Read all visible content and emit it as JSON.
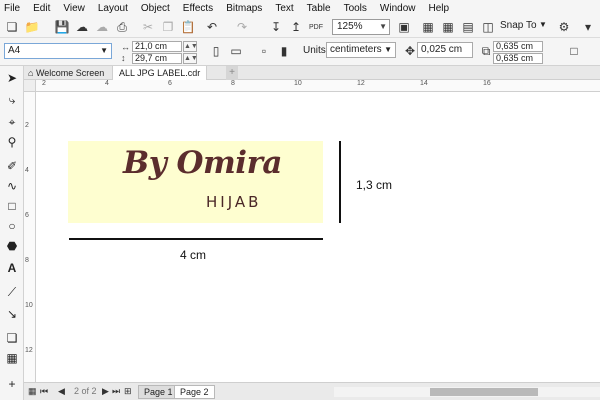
{
  "menu": [
    {
      "label": "File",
      "name": "menu-file"
    },
    {
      "label": "Edit",
      "name": "menu-edit"
    },
    {
      "label": "View",
      "name": "menu-view"
    },
    {
      "label": "Layout",
      "name": "menu-layout"
    },
    {
      "label": "Object",
      "name": "menu-object"
    },
    {
      "label": "Effects",
      "name": "menu-effects"
    },
    {
      "label": "Bitmaps",
      "name": "menu-bitmaps"
    },
    {
      "label": "Text",
      "name": "menu-text"
    },
    {
      "label": "Table",
      "name": "menu-table"
    },
    {
      "label": "Tools",
      "name": "menu-tools"
    },
    {
      "label": "Window",
      "name": "menu-window"
    },
    {
      "label": "Help",
      "name": "menu-help"
    }
  ],
  "toolbar": {
    "zoom": "125%",
    "snap_to": "Snap To",
    "pdf_label": "PDF"
  },
  "propbar": {
    "page_size": "A4",
    "width": "21,0 cm",
    "height": "29,7 cm",
    "units_label": "Units:",
    "units": "centimeters",
    "nudge": "0,025 cm",
    "dup_x": "0,635 cm",
    "dup_y": "0,635 cm"
  },
  "tabs": {
    "welcome": "Welcome Screen",
    "document": "ALL JPG LABEL.cdr",
    "add": "+"
  },
  "ruler": {
    "h_numbers": [
      "2",
      "4",
      "6",
      "8",
      "10",
      "12",
      "14",
      "16"
    ],
    "v_numbers": [
      "2",
      "4",
      "6",
      "8",
      "10",
      "12"
    ]
  },
  "canvas": {
    "brand": "By Omira",
    "sub": "HIJAB",
    "width_dim": "4 cm",
    "height_dim": "1,3 cm",
    "label_color": "#fefed0",
    "brand_color": "#5b2d2d"
  },
  "pages": {
    "count": "2 of 2",
    "tabs": [
      "Page 1",
      "Page 2"
    ]
  }
}
